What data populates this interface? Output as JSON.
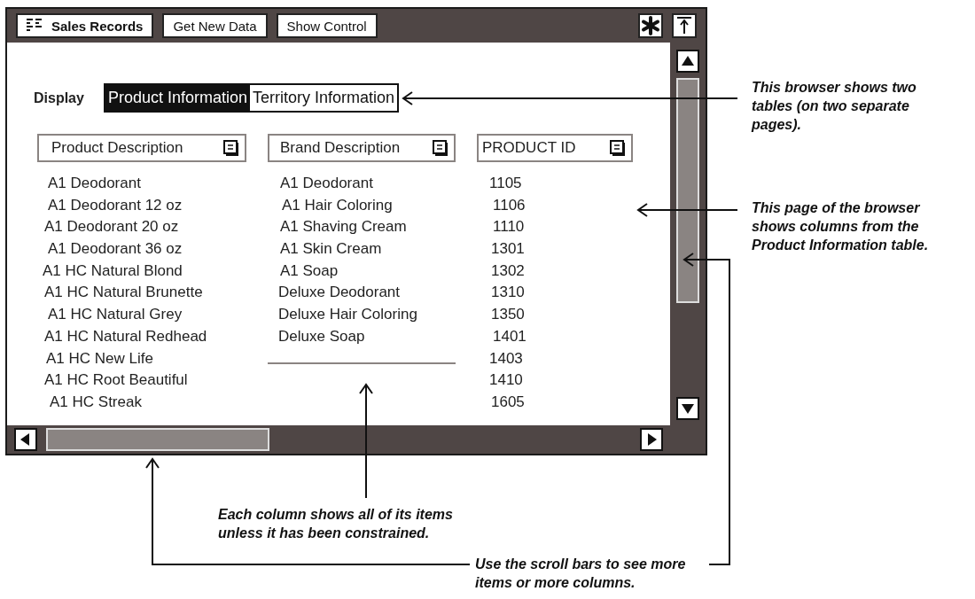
{
  "window": {
    "title": "Sales Records"
  },
  "toolbar_buttons": [
    "Get New Data",
    "Show Control"
  ],
  "display": {
    "label": "Display",
    "tabs": [
      {
        "label": "Product Information",
        "selected": true
      },
      {
        "label": "Territory Information",
        "selected": false
      }
    ]
  },
  "columns": [
    {
      "header": "Product Description",
      "items": [
        "A1 Deodorant",
        "A1 Deodorant 12 oz",
        "A1 Deodorant 20 oz",
        "A1 Deodorant 36 oz",
        "A1 HC Natural Blond",
        "A1 HC Natural Brunette",
        "A1 HC Natural Grey",
        "A1 HC Natural Redhead",
        "A1 HC New Life",
        "A1 HC Root Beautiful",
        "A1 HC Streak"
      ]
    },
    {
      "header": "Brand Description",
      "items": [
        "A1 Deodorant",
        "A1 Hair Coloring",
        "A1 Shaving Cream",
        "A1 Skin Cream",
        "A1 Soap",
        "Deluxe Deodorant",
        "Deluxe Hair Coloring",
        "Deluxe Soap"
      ]
    },
    {
      "header": "PRODUCT ID",
      "items": [
        "1105",
        "1106",
        "1110",
        "1301",
        "1302",
        "1310",
        "1350",
        "1401",
        "1403",
        "1410",
        "1605"
      ]
    }
  ],
  "annotations": [
    {
      "text": "This browser shows two tables (on two separate pages)."
    },
    {
      "text": "This page of the browser shows columns from the Product Information table."
    },
    {
      "text": "Each column shows all of its items unless it has been constrained."
    },
    {
      "text": "Use the scroll bars to see more items or more columns."
    }
  ]
}
